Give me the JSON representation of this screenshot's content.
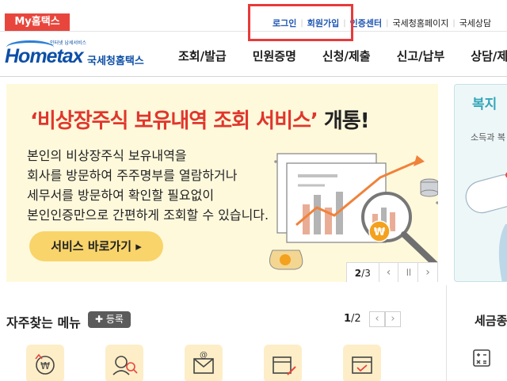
{
  "topbar": {
    "my_hometax": "My홈택스",
    "login": "로그인",
    "signup": "회원가입",
    "cert_center": "인증센터",
    "national_page": "국세청홈페이지",
    "consult": "국세상담"
  },
  "logo": {
    "tagline": "인터넷 납세서비스",
    "main": "Hometax",
    "sub": "국세청홈택스"
  },
  "nav": [
    "조회/발급",
    "민원증명",
    "신청/제출",
    "신고/납부",
    "상담/제보"
  ],
  "banner": {
    "title_highlight": "‘비상장주식 보유내역 조회 서비스’",
    "title_rest": " 개통!",
    "lines": [
      "본인의 비상장주식 보유내역을",
      "회사를 방문하여 주주명부를 열람하거나",
      "세무서를 방문하여 확인할 필요없이",
      "본인인증만으로 간편하게 조회할 수 있습니다."
    ],
    "button": "서비스 바로가기",
    "pager_current": "2",
    "pager_total": "/3",
    "prev": "‹",
    "pause": "॥",
    "next": "›",
    "won": "₩"
  },
  "side_card": {
    "title": "복지",
    "subtitle": "소득과 복"
  },
  "frequent": {
    "title": "자주찾는 메뉴",
    "register": "등록",
    "page_current": "1",
    "page_total": "/2",
    "prev": "‹",
    "next": "›"
  },
  "tax_section": {
    "title": "세금종"
  },
  "colors": {
    "accent_red": "#e0362c",
    "brand_blue": "#0c4fa6",
    "banner_bg": "#fff9dc",
    "button_yellow": "#f8d46a",
    "teal": "#34a7b8"
  }
}
